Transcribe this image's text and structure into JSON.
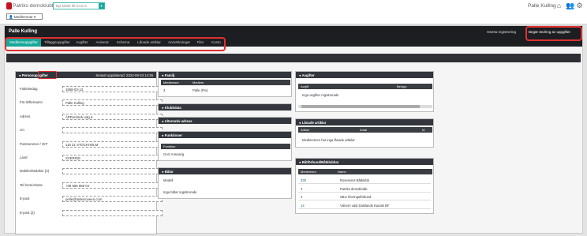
{
  "header": {
    "club_name": "Patriks demoklubb",
    "club_select": "Byt klubb till GAS K",
    "member_button": "Medlemmar",
    "user_name": "Palle Kulling"
  },
  "member": {
    "name": "Palle Kulling",
    "link_register": "Hämta registrering",
    "link_request": "Begär ändring av uppgifter"
  },
  "tabs": [
    "Medlemsuppgifter",
    "Tilläggsuppgifter",
    "Avgifter",
    "Aviserat",
    "Schema",
    "Lånade artiklar",
    "Anmärkningar",
    "Filer",
    "Konto"
  ],
  "personal": {
    "title": "Personuppgifter",
    "updated": "Senast uppdaterad: 2022-09-23 14:25",
    "fields": [
      {
        "label": "Födelsedag",
        "value": "1968-03-13"
      },
      {
        "label": "För-/Efternamn",
        "value": "Palle Kulling"
      },
      {
        "label": "Adress",
        "value": "ÄPPerstrelv väg 6"
      },
      {
        "label": "c/o",
        "value": ""
      },
      {
        "label": "Postnummer / Ort*",
        "value": "115 21 STOCKHOLM"
      },
      {
        "label": "Land",
        "value": "SVERIGE"
      },
      {
        "label": "Mobiler/Mobiltnr (2)",
        "value": ""
      },
      {
        "label": "Tel hem/Arbete",
        "value": "+08 565 859 04"
      },
      {
        "label": "E-post",
        "value": "pelle@tankeroveen.com"
      },
      {
        "label": "E-post (2)",
        "value": ""
      }
    ]
  },
  "family": {
    "title": "Familj",
    "col1": "Medlemsnr",
    "col2": "Medlem",
    "row": {
      "nr": "3",
      "name": "Palle (Pin)"
    }
  },
  "club_data": {
    "title": "Klubbdata"
  },
  "alt_address": {
    "title": "Alternativ adress"
  },
  "functions": {
    "title": "Funktioner",
    "col": "Funktion",
    "value": "GAS Ansvarig"
  },
  "boats": {
    "title": "Båtar",
    "col": "Modell",
    "empty": "Inga båtar registrerade"
  },
  "fees": {
    "title": "Avgifter",
    "col1": "Avgift",
    "col2": "Belopp",
    "empty": "Inga avgifter registrerade"
  },
  "loans": {
    "title": "Lånade artiklar",
    "col1": "Artikel",
    "col2": "Antal",
    "col3": "Id",
    "empty": "Medlemmen har inga lånade artiklar"
  },
  "clubs": {
    "title": "Båtförbund/Båtklubbar",
    "col1": "Medlemsnr",
    "col2": "Namn",
    "rows": [
      {
        "nr": "330",
        "name": "Rosenvins Båtklubb"
      },
      {
        "nr": "3",
        "name": "Patriks demoklubb"
      },
      {
        "nr": "3",
        "name": "SBU Övningsförbund"
      },
      {
        "nr": "14",
        "name": "Vänern väst Dalslands Kanals BF"
      }
    ]
  }
}
